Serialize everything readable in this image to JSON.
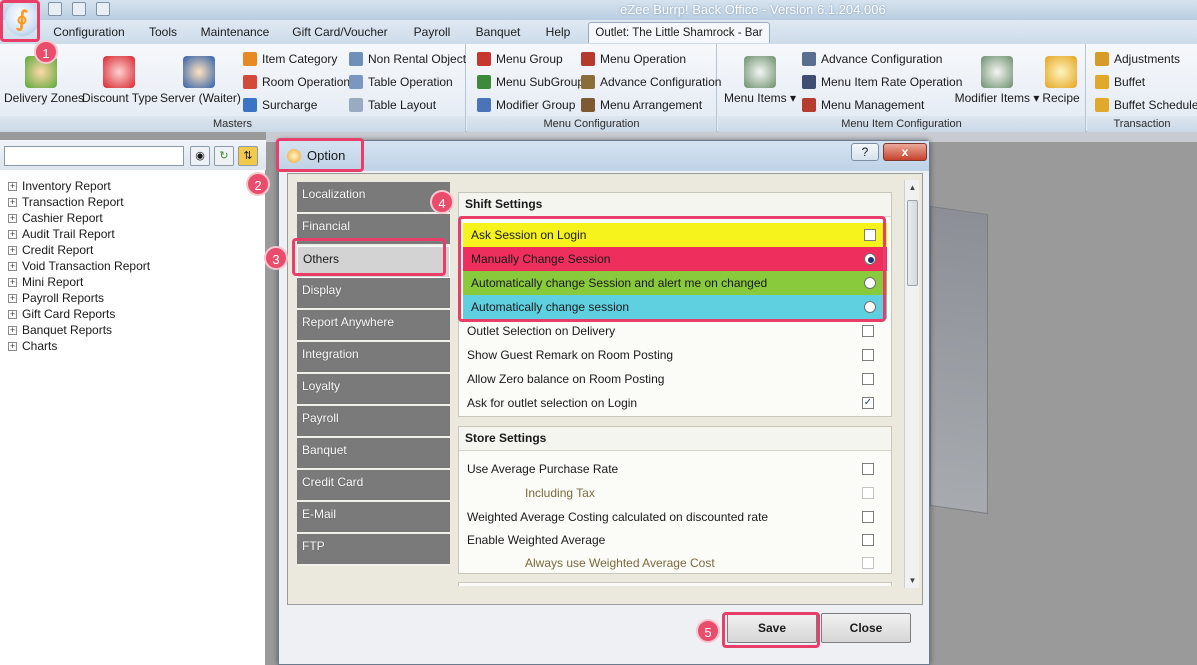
{
  "window": {
    "title": "eZee Burrp! Back Office - Version 6.1.204.006"
  },
  "menu_tabs": [
    {
      "label": "Configuration"
    },
    {
      "label": "Tools"
    },
    {
      "label": "Maintenance"
    },
    {
      "label": "Gift Card/Voucher"
    },
    {
      "label": "Payroll"
    },
    {
      "label": "Banquet"
    },
    {
      "label": "Help"
    },
    {
      "label": "Outlet: The Little Shamrock - Bar"
    }
  ],
  "ribbon": {
    "masters": {
      "label": "Masters",
      "big": [
        "Delivery Zones",
        "Discount Type",
        "Server (Waiter)"
      ],
      "small": [
        "Item Category",
        "Room Operation",
        "Surcharge",
        "Non Rental Object",
        "Table Operation",
        "Table Layout"
      ]
    },
    "menu_config": {
      "label": "Menu Configuration",
      "small": [
        "Menu Group",
        "Menu SubGroup",
        "Modifier Group",
        "Menu Operation",
        "Advance Configuration",
        "Menu Arrangement"
      ]
    },
    "menu_item_config": {
      "label": "Menu Item Configuration",
      "big": [
        "Menu Items",
        "Modifier Items",
        "Recipe"
      ],
      "small": [
        "Advance Configuration",
        "Menu Item Rate Operation",
        "Menu Management"
      ]
    },
    "transaction": {
      "label": "Transaction",
      "small": [
        "Adjustments",
        "Buffet",
        "Buffet Schedule"
      ]
    }
  },
  "sidebar": {
    "search_value": "",
    "items": [
      "Inventory Report",
      "Transaction Report",
      "Cashier Report",
      "Audit Trail Report",
      "Credit Report",
      "Void Transaction Report",
      "Mini Report",
      "Payroll Reports",
      "Gift Card Reports",
      "Banquet Reports",
      "Charts"
    ]
  },
  "dialog": {
    "title": "Option",
    "help": "?",
    "close": "x",
    "nav": [
      "Localization",
      "Financial",
      "Others",
      "Display",
      "Report Anywhere",
      "Integration",
      "Loyalty",
      "Payroll",
      "Banquet",
      "Credit Card",
      "E-Mail",
      "FTP"
    ],
    "nav_selected": "Others",
    "shift": {
      "title": "Shift Settings",
      "rows": [
        {
          "label": "Ask Session on Login",
          "type": "checkbox",
          "checked": false,
          "color": "#f6f21c"
        },
        {
          "label": "Manually Change Session",
          "type": "radio",
          "checked": true,
          "color": "#ee2e5d"
        },
        {
          "label": "Automatically change Session and alert me on changed",
          "type": "radio",
          "checked": false,
          "color": "#89c93c"
        },
        {
          "label": "Automatically change session",
          "type": "radio",
          "checked": false,
          "color": "#5fd0e0"
        },
        {
          "label": "Outlet Selection on Delivery",
          "type": "checkbox",
          "checked": false
        },
        {
          "label": "Show Guest Remark on Room Posting",
          "type": "checkbox",
          "checked": false
        },
        {
          "label": "Allow Zero balance on Room Posting",
          "type": "checkbox",
          "checked": false
        },
        {
          "label": "Ask for outlet selection on Login",
          "type": "checkbox",
          "checked": true
        }
      ]
    },
    "store": {
      "title": "Store Settings",
      "rows": [
        {
          "label": "Use Average Purchase Rate",
          "sub": false,
          "checked": false
        },
        {
          "label": "Including Tax",
          "sub": true,
          "checked": false
        },
        {
          "label": "Weighted Average Costing calculated on discounted rate",
          "sub": false,
          "checked": false
        },
        {
          "label": "Enable Weighted Average",
          "sub": false,
          "checked": false
        },
        {
          "label": "Always use Weighted Average Cost",
          "sub": true,
          "checked": false
        }
      ]
    },
    "save_label": "Save",
    "close_label": "Close"
  },
  "callouts": [
    "1",
    "2",
    "3",
    "4",
    "5"
  ],
  "colors": {
    "highlight": "#ea3e6a",
    "badge": "#ea4d6c"
  }
}
